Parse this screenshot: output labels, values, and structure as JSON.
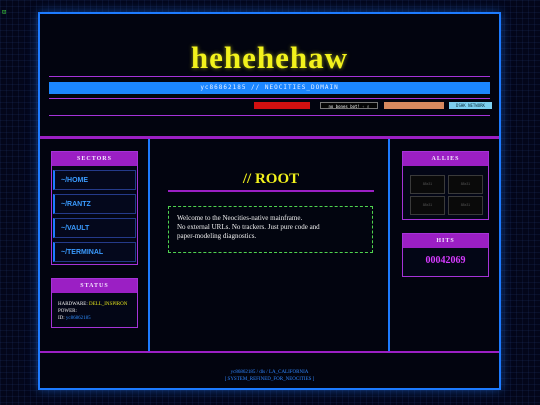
{
  "corner_glyph": "⊡",
  "header": {
    "title": "hehehehaw",
    "subtitle": "yc86862185 // NEOCITIES_DOMAIN",
    "badges": [
      {
        "label": "",
        "color": "#d11010"
      },
      {
        "label": "no bones bot! ◦ ▯",
        "color": "#050505"
      },
      {
        "label": "",
        "color": "#d7895f"
      },
      {
        "label": "DSHK NETWORK",
        "color": "#7dd0f0"
      }
    ]
  },
  "sectors": {
    "title": "SECTORS",
    "items": [
      "~/HOME",
      "~/RANTZ",
      "~/VAULT",
      "~/TERMINAL"
    ]
  },
  "status": {
    "title": "STATUS",
    "hardware_label": "HARDWARE:",
    "hardware_value": "DELL_INSPIRON",
    "power_label": "POWER:",
    "power_value": "",
    "id_label": "ID:",
    "id_value": "yc86862185"
  },
  "main": {
    "heading": "// ROOT",
    "lines": [
      "Welcome to the Neocities-native mainframe.",
      "No external URLs. No trackers. Just pure code and",
      "paper-modeling diagnostics."
    ]
  },
  "allies": {
    "title": "ALLIES",
    "slots": [
      "88x31",
      "88x31",
      "88x31",
      "88x31"
    ]
  },
  "hits": {
    "title": "HITS",
    "count": "00042069"
  },
  "footer": {
    "line1": "yc86862185 / dls / LA_CALIFORNIA",
    "line2": "[ SYSTEM_REFINED_FOR_NEOCITIES ]"
  },
  "colors": {
    "accent_blue": "#1d7bff",
    "accent_purple": "#9b1fc4",
    "title_yellow": "#f2f21c",
    "hits_magenta": "#d63bff",
    "terminal_green": "#4fd34f"
  }
}
